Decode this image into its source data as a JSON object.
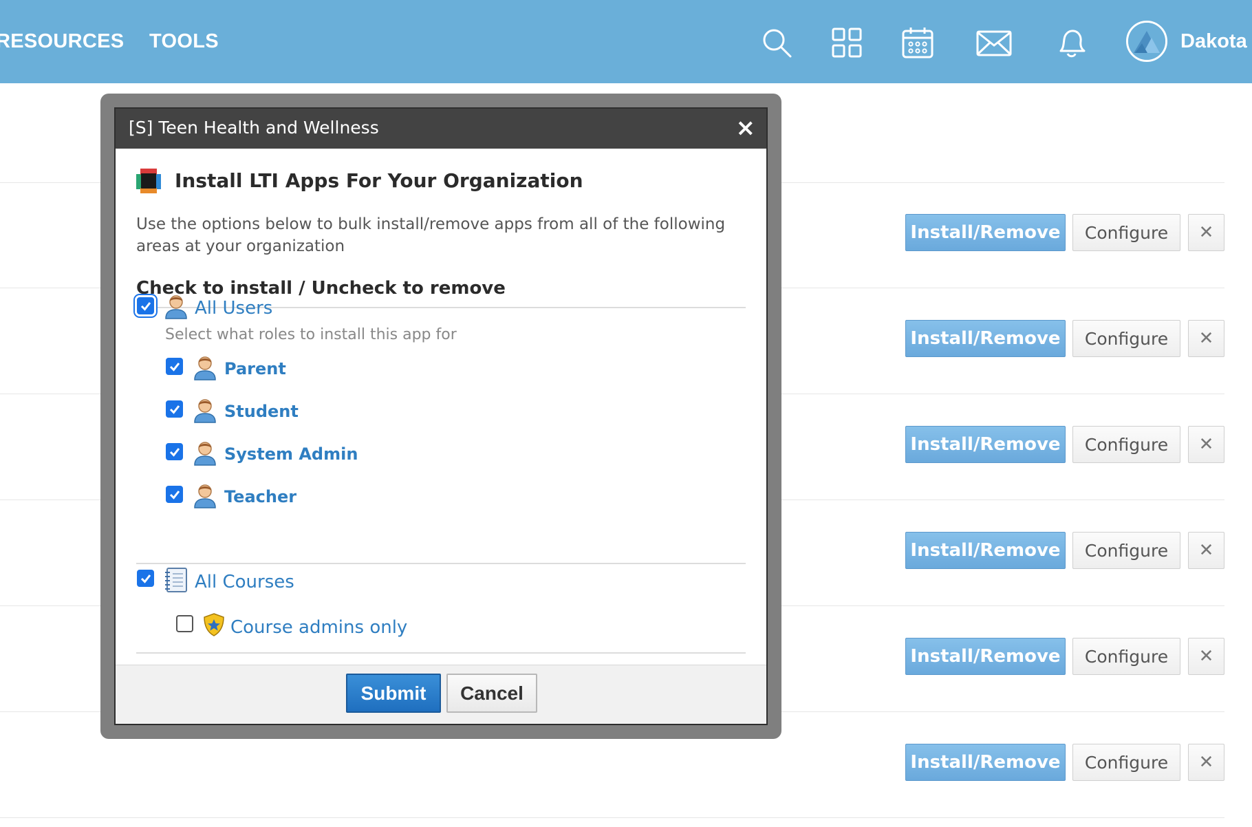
{
  "nav": {
    "resources_label": "RESOURCES",
    "tools_label": "TOOLS",
    "user_name": "Dakota",
    "icons": [
      "search-icon",
      "apps-grid-icon",
      "calendar-icon",
      "mail-icon",
      "notifications-bell-icon",
      "avatar"
    ]
  },
  "rows": [
    {
      "install_label": "Install/Remove",
      "configure_label": "Configure",
      "remove_label": "✕"
    },
    {
      "install_label": "Install/Remove",
      "configure_label": "Configure",
      "remove_label": "✕"
    },
    {
      "install_label": "Install/Remove",
      "configure_label": "Configure",
      "remove_label": "✕"
    },
    {
      "install_label": "Install/Remove",
      "configure_label": "Configure",
      "remove_label": "✕"
    },
    {
      "install_label": "Install/Remove",
      "configure_label": "Configure",
      "remove_label": "✕"
    },
    {
      "install_label": "Install/Remove",
      "configure_label": "Configure",
      "remove_label": "✕"
    }
  ],
  "modal": {
    "title": "[S] Teen Health and Wellness",
    "close_label": "×",
    "heading": "Install LTI Apps For Your Organization",
    "description": "Use the options below to bulk install/remove apps from all of the following areas at your organization",
    "instruction": "Check to install / Uncheck to remove",
    "all_users": {
      "label": "All Users",
      "checked": true
    },
    "roles_hint": "Select what roles to install this app for",
    "roles": [
      {
        "label": "Parent",
        "checked": true
      },
      {
        "label": "Student",
        "checked": true
      },
      {
        "label": "System Admin",
        "checked": true
      },
      {
        "label": "Teacher",
        "checked": true
      }
    ],
    "all_courses": {
      "label": "All Courses",
      "checked": true
    },
    "course_admins": {
      "label": "Course admins only",
      "checked": false
    },
    "submit_label": "Submit",
    "cancel_label": "Cancel"
  },
  "colors": {
    "topbar": "#6aafd9",
    "modal_header": "#434343",
    "link_blue": "#2f7ec1",
    "install_button": "#7ab6e3",
    "submit_button": "#2a7fcc",
    "checkbox": "#1a73e8"
  }
}
